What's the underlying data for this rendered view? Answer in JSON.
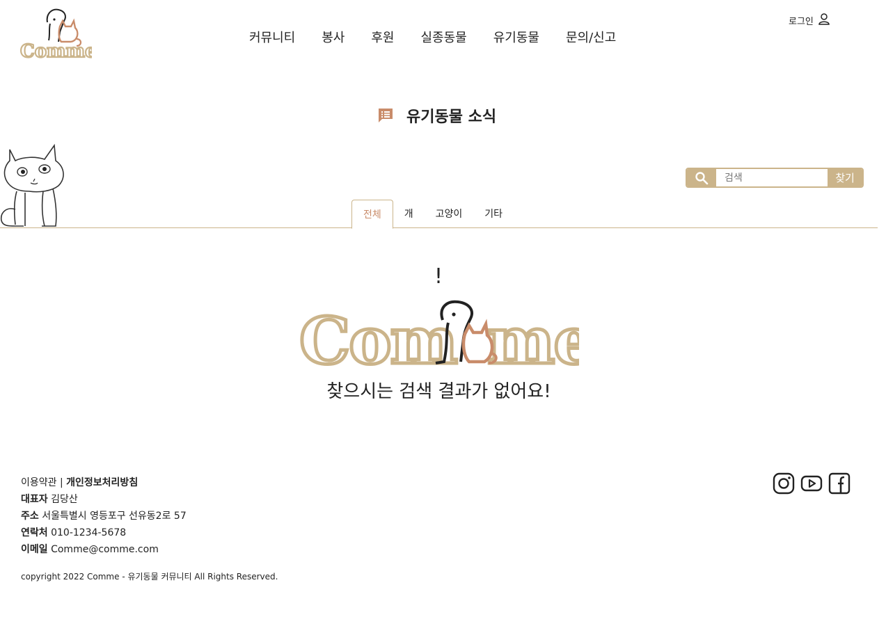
{
  "header": {
    "logo_text": "Comme",
    "nav": [
      "커뮤니티",
      "봉사",
      "후원",
      "실종동물",
      "유기동물",
      "문의/신고"
    ],
    "login_label": "로그인"
  },
  "page": {
    "title": "유기동물 소식"
  },
  "search": {
    "placeholder": "검색",
    "button": "찾기"
  },
  "tabs": [
    "전체",
    "개",
    "고양이",
    "기타"
  ],
  "active_tab": "전체",
  "empty": {
    "exclaim": "!",
    "logo_text": "Comme",
    "message": "찾으시는 검색 결과가 없어요!"
  },
  "footer": {
    "terms": "이용약관",
    "separator": "|",
    "privacy": "개인정보처리방침",
    "rep_label": "대표자",
    "rep_value": "김당산",
    "addr_label": "주소",
    "addr_value": "서울특별시 영등포구 선유동2로 57",
    "contact_label": "연락처",
    "contact_value": "010-1234-5678",
    "email_label": "이메일",
    "email_value": "Comme@comme.com",
    "copyright": "copyright 2022 Comme - 유기동물 커뮤니티 All Rights Reserved."
  },
  "socials": [
    "instagram-icon",
    "youtube-icon",
    "facebook-icon"
  ],
  "colors": {
    "accent": "#cbb48a",
    "accent_orange": "#c98c6a",
    "text": "#222222"
  }
}
